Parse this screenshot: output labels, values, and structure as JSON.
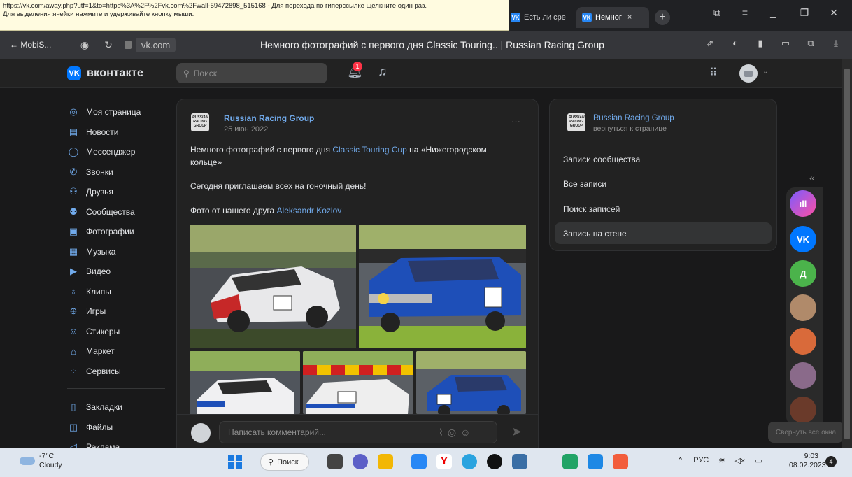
{
  "browser": {
    "tooltip_line1": "https://vk.com/away.php?utf=1&to=https%3A%2F%2Fvk.com%2Fwall-59472898_515168 - Для перехода по гиперссылке щелкните один раз.",
    "tooltip_line2": "Для выделения ячейки нажмите и удерживайте кнопку мыши.",
    "tab1_label": "Есть ли сре",
    "tab2_label": "Немног",
    "tab_close": "×",
    "new_tab": "+",
    "back_label": "← MobiS...",
    "host": "vk.com",
    "page_title": "Немного фотографий с первого дня Classic Touring.. | Russian Racing Group"
  },
  "vk": {
    "logo_letter": "VK",
    "logo_text": "вконтакте",
    "search_placeholder": "Поиск",
    "notif_count": "1"
  },
  "menu": {
    "items": [
      {
        "label": "Моя страница",
        "icon": "user-circle-icon"
      },
      {
        "label": "Новости",
        "icon": "news-icon"
      },
      {
        "label": "Мессенджер",
        "icon": "chat-icon"
      },
      {
        "label": "Звонки",
        "icon": "phone-icon"
      },
      {
        "label": "Друзья",
        "icon": "friends-icon"
      },
      {
        "label": "Сообщества",
        "icon": "groups-icon"
      },
      {
        "label": "Фотографии",
        "icon": "photo-icon"
      },
      {
        "label": "Музыка",
        "icon": "music-icon"
      },
      {
        "label": "Видео",
        "icon": "video-icon"
      },
      {
        "label": "Клипы",
        "icon": "clips-icon"
      },
      {
        "label": "Игры",
        "icon": "gamepad-icon"
      },
      {
        "label": "Стикеры",
        "icon": "sticker-icon"
      },
      {
        "label": "Маркет",
        "icon": "bag-icon"
      },
      {
        "label": "Сервисы",
        "icon": "services-icon"
      }
    ],
    "extra": [
      {
        "label": "Закладки",
        "icon": "bookmark-icon"
      },
      {
        "label": "Файлы",
        "icon": "file-icon"
      },
      {
        "label": "Реклама",
        "icon": "megaphone-icon"
      }
    ]
  },
  "post": {
    "author": "Russian Racing Group",
    "date": "25 июн 2022",
    "more": "···",
    "line1_a": "Немного фотографий с первого дня ",
    "line1_link": "Classic Touring Cup",
    "line1_b": " на «Нижегородском",
    "line1_c": "кольце»",
    "line2": "Сегодня приглашаем всех на гоночный день!",
    "line3_a": "Фото от нашего друга ",
    "line3_link": "Aleksandr Kozlov",
    "comment_placeholder": "Написать комментарий..."
  },
  "logo_text": "RUSSIAN RACING GROUP",
  "side": {
    "group": "Russian Racing Group",
    "back": "вернуться к странице",
    "items": [
      "Записи сообщества",
      "Все записи",
      "Поиск записей",
      "Запись на стене"
    ]
  },
  "dock": {
    "letter_d": "Д",
    "hint": "Свернуть все окна"
  },
  "taskbar": {
    "temp": "-7°C",
    "weather": "Cloudy",
    "search": "Поиск",
    "lang": "РУС",
    "time": "9:03",
    "date": "08.02.2023",
    "notif": "4"
  },
  "colors": {
    "accent": "#71aaeb",
    "vk_blue": "#0077ff",
    "bg": "#19191a",
    "card": "#222222"
  }
}
